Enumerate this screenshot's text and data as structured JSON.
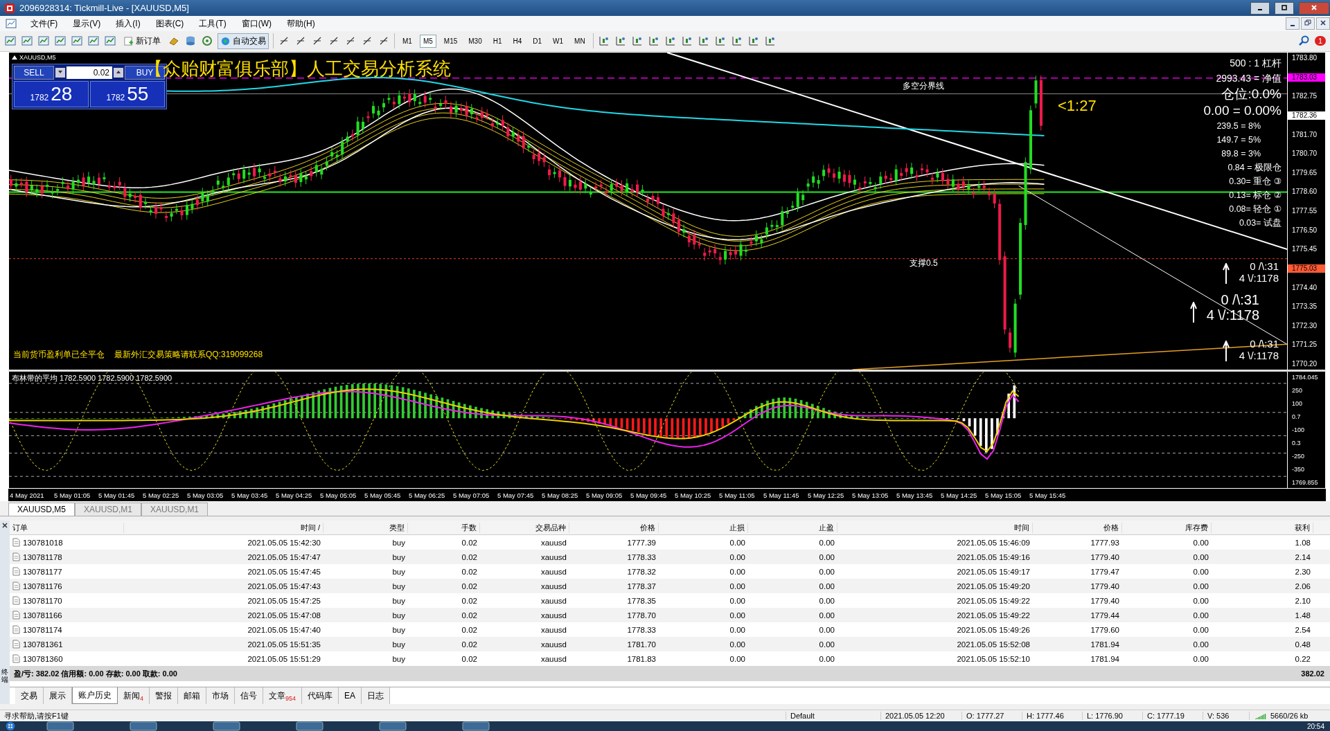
{
  "window": {
    "title": "2096928314: Tickmill-Live - [XAUUSD,M5]"
  },
  "menu": [
    "文件(F)",
    "显示(V)",
    "插入(I)",
    "图表(C)",
    "工具(T)",
    "窗口(W)",
    "帮助(H)"
  ],
  "toolbar": {
    "new_order": "新订单",
    "auto_trading": "自动交易",
    "notifications": "1",
    "timeframes": [
      {
        "label": "M1",
        "selected": false
      },
      {
        "label": "M5",
        "selected": true
      },
      {
        "label": "M15",
        "selected": false
      },
      {
        "label": "M30",
        "selected": false
      },
      {
        "label": "H1",
        "selected": false
      },
      {
        "label": "H4",
        "selected": false
      },
      {
        "label": "D1",
        "selected": false
      },
      {
        "label": "W1",
        "selected": false
      },
      {
        "label": "MN",
        "selected": false
      }
    ]
  },
  "chart": {
    "symbol": "XAUUSD,M5",
    "trade_panel": {
      "sell": "SELL",
      "lots": "0.02",
      "buy": "BUY",
      "bid_big": "1782",
      "bid_small": "28",
      "ask_big": "1782",
      "ask_small": "55"
    },
    "title": "【众贻财富俱乐部】人工交易分析系统",
    "divider_label": "多空分界线",
    "countdown": "<1:27",
    "support_label": "支撑0.5",
    "notes": [
      "当前货币盈利单已全平仓",
      "最新外汇交易策略请联系QQ:319099268"
    ],
    "account_panel": [
      {
        "text": "500 : 1 杠杆",
        "kind": "normal"
      },
      {
        "text": "2993.43 = 净值",
        "kind": "normal"
      },
      {
        "text": "仓位:0.0%",
        "kind": "large"
      },
      {
        "text": "0.00 = 0.00%",
        "kind": "large"
      },
      {
        "text": "239.5 = 8%",
        "kind": "small"
      },
      {
        "text": "149.7 = 5%",
        "kind": "small"
      },
      {
        "text": "89.8 = 3%",
        "kind": "small"
      },
      {
        "text": "0.84 = 极限仓",
        "kind": "small"
      },
      {
        "text": "0.30= 重仓 ③",
        "kind": "small"
      },
      {
        "text": "0.13= 标仓 ②",
        "kind": "small"
      },
      {
        "text": "0.08= 轻仓 ①",
        "kind": "small"
      },
      {
        "text": "0.03= 试盘",
        "kind": "small"
      }
    ],
    "signals": [
      {
        "line1": "0 /\\:31",
        "line2": "4 \\/:1178",
        "kind": "small"
      },
      {
        "line1": "0 /\\:31",
        "line2": "4 \\/:1178",
        "kind": "large"
      },
      {
        "line1": "0 /\\:31",
        "line2": "4 \\/:1178",
        "kind": "small"
      }
    ],
    "price_axis": [
      {
        "label": "1783.80"
      },
      {
        "label": "1783.03",
        "color": "#ff00ff"
      },
      {
        "label": "1782.75"
      },
      {
        "label": "1782.36",
        "color": "#ffffff"
      },
      {
        "label": "1781.70"
      },
      {
        "label": "1780.70"
      },
      {
        "label": "1779.65"
      },
      {
        "label": "1778.60"
      },
      {
        "label": "1777.55"
      },
      {
        "label": "1776.50"
      },
      {
        "label": "1775.45"
      },
      {
        "label": "1775.03",
        "color": "#ff5a36"
      },
      {
        "label": "1774.40"
      },
      {
        "label": "1773.35"
      },
      {
        "label": "1772.30"
      },
      {
        "label": "1771.25"
      },
      {
        "label": "1770.20"
      }
    ],
    "indicator": {
      "label": "布林带的平均 1782.5900 1782.5900 1782.5900",
      "axis": [
        "1784.045",
        "250",
        "100",
        "0.7",
        "-100",
        "0.3",
        "-250",
        "-350",
        "1769.855"
      ]
    },
    "time_axis": [
      "4 May 2021",
      "5 May 01:05",
      "5 May 01:45",
      "5 May 02:25",
      "5 May 03:05",
      "5 May 03:45",
      "5 May 04:25",
      "5 May 05:05",
      "5 May 05:45",
      "5 May 06:25",
      "5 May 07:05",
      "5 May 07:45",
      "5 May 08:25",
      "5 May 09:05",
      "5 May 09:45",
      "5 May 10:25",
      "5 May 11:05",
      "5 May 11:45",
      "5 May 12:25",
      "5 May 13:05",
      "5 May 13:45",
      "5 May 14:25",
      "5 May 15:05",
      "5 May 15:45"
    ]
  },
  "chart_tabs": [
    {
      "label": "XAUUSD,M5",
      "selected": true
    },
    {
      "label": "XAUUSD,M1",
      "selected": false
    },
    {
      "label": "XAUUSD,M1",
      "selected": false
    }
  ],
  "table": {
    "columns": [
      "订单",
      "时间 /",
      "类型",
      "手数",
      "交易品种",
      "价格",
      "止损",
      "止盈",
      "时间",
      "价格",
      "库存费",
      "获利"
    ],
    "rows": [
      [
        "130781018",
        "2021.05.05 15:42:30",
        "buy",
        "0.02",
        "xauusd",
        "1777.39",
        "0.00",
        "0.00",
        "2021.05.05 15:46:09",
        "1777.93",
        "0.00",
        "1.08"
      ],
      [
        "130781178",
        "2021.05.05 15:47:47",
        "buy",
        "0.02",
        "xauusd",
        "1778.33",
        "0.00",
        "0.00",
        "2021.05.05 15:49:16",
        "1779.40",
        "0.00",
        "2.14"
      ],
      [
        "130781177",
        "2021.05.05 15:47:45",
        "buy",
        "0.02",
        "xauusd",
        "1778.32",
        "0.00",
        "0.00",
        "2021.05.05 15:49:17",
        "1779.47",
        "0.00",
        "2.30"
      ],
      [
        "130781176",
        "2021.05.05 15:47:43",
        "buy",
        "0.02",
        "xauusd",
        "1778.37",
        "0.00",
        "0.00",
        "2021.05.05 15:49:20",
        "1779.40",
        "0.00",
        "2.06"
      ],
      [
        "130781170",
        "2021.05.05 15:47:25",
        "buy",
        "0.02",
        "xauusd",
        "1778.35",
        "0.00",
        "0.00",
        "2021.05.05 15:49:22",
        "1779.40",
        "0.00",
        "2.10"
      ],
      [
        "130781166",
        "2021.05.05 15:47:08",
        "buy",
        "0.02",
        "xauusd",
        "1778.70",
        "0.00",
        "0.00",
        "2021.05.05 15:49:22",
        "1779.44",
        "0.00",
        "1.48"
      ],
      [
        "130781174",
        "2021.05.05 15:47:40",
        "buy",
        "0.02",
        "xauusd",
        "1778.33",
        "0.00",
        "0.00",
        "2021.05.05 15:49:26",
        "1779.60",
        "0.00",
        "2.54"
      ],
      [
        "130781361",
        "2021.05.05 15:51:35",
        "buy",
        "0.02",
        "xauusd",
        "1781.70",
        "0.00",
        "0.00",
        "2021.05.05 15:52:08",
        "1781.94",
        "0.00",
        "0.48"
      ],
      [
        "130781360",
        "2021.05.05 15:51:29",
        "buy",
        "0.02",
        "xauusd",
        "1781.83",
        "0.00",
        "0.00",
        "2021.05.05 15:52:10",
        "1781.94",
        "0.00",
        "0.22"
      ]
    ],
    "summary": "盈/亏: 382.02  信用额: 0.00  存款: 0.00  取款: 0.00",
    "summary_total": "382.02"
  },
  "terminal_label": "终端",
  "terminal_tabs": [
    {
      "label": "交易",
      "selected": false
    },
    {
      "label": "展示",
      "selected": false
    },
    {
      "label": "账户历史",
      "selected": true
    },
    {
      "label": "新闻",
      "badge": "4",
      "selected": false
    },
    {
      "label": "警报",
      "selected": false
    },
    {
      "label": "邮箱",
      "selected": false
    },
    {
      "label": "市场",
      "selected": false
    },
    {
      "label": "信号",
      "selected": false
    },
    {
      "label": "文章",
      "badge": "954",
      "selected": false
    },
    {
      "label": "代码库",
      "selected": false
    },
    {
      "label": "EA",
      "selected": false
    },
    {
      "label": "日志",
      "selected": false
    }
  ],
  "status_bar": {
    "help": "寻求帮助,请按F1键",
    "profile": "Default",
    "time": "2021.05.05 12:20",
    "open": "O: 1777.27",
    "high": "H: 1777.46",
    "low": "L: 1776.90",
    "close": "C: 1777.19",
    "volume": "V: 536",
    "traffic": "5660/26 kb"
  },
  "taskbar": {
    "clock": "20:54"
  }
}
